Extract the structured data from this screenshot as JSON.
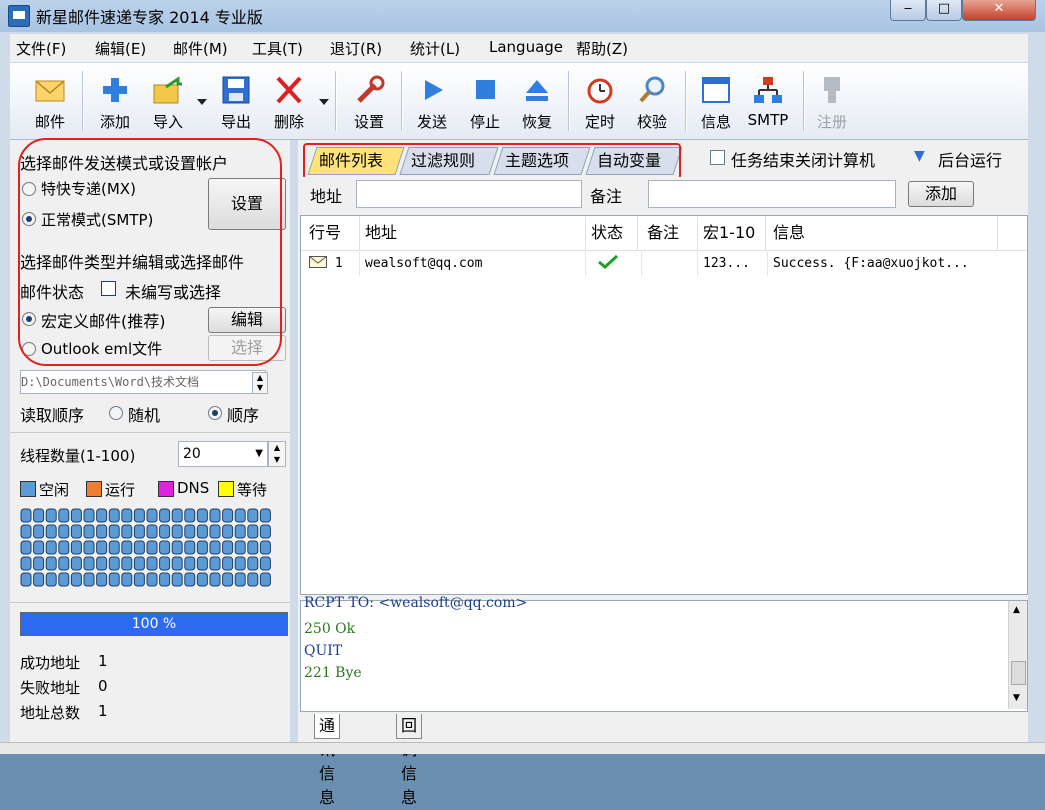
{
  "window": {
    "title": "新星邮件速递专家 2014 专业版",
    "min": "‒",
    "max": "□",
    "close": "✕"
  },
  "menu": [
    "文件(F)",
    "编辑(E)",
    "邮件(M)",
    "工具(T)",
    "退订(R)",
    "统计(L)",
    "Language",
    "帮助(Z)"
  ],
  "toolbar": {
    "mail": "邮件",
    "add": "添加",
    "import": "导入",
    "export": "导出",
    "delete": "删除",
    "settings": "设置",
    "send": "发送",
    "stop": "停止",
    "resume": "恢复",
    "timer": "定时",
    "check": "校验",
    "info": "信息",
    "smtp": "SMTP",
    "register": "注册"
  },
  "left": {
    "section_mode": "选择邮件发送模式或设置帐户",
    "mode_mx": "特快专递(MX)",
    "mode_smtp": "正常模式(SMTP)",
    "settings_btn": "设置",
    "section_type": "选择邮件类型并编辑或选择邮件",
    "mail_status_label": "邮件状态",
    "mail_status_value": "未编写或选择",
    "macro_mail": "宏定义邮件(推荐)",
    "edit_btn": "编辑",
    "eml_file": "Outlook eml文件",
    "select_btn": "选择",
    "path": "D:\\Documents\\Word\\技术文档",
    "read_order": "读取顺序",
    "order_random": "随机",
    "order_seq": "顺序",
    "threads_label": "线程数量(1-100)",
    "threads_value": "20",
    "legend": [
      {
        "label": "空闲",
        "color": "#5b9bd5"
      },
      {
        "label": "运行",
        "color": "#ed7d31"
      },
      {
        "label": "DNS",
        "color": "#e023e0"
      },
      {
        "label": "等待",
        "color": "#ffff00"
      }
    ],
    "progress": "100 %",
    "progress_fraction": 1.0,
    "success_label": "成功地址",
    "success_value": "1",
    "fail_label": "失败地址",
    "fail_value": "0",
    "total_label": "地址总数",
    "total_value": "1"
  },
  "tabs": [
    "邮件列表",
    "过滤规则",
    "主题选项",
    "自动变量"
  ],
  "shutdown_option": "任务结束关闭计算机",
  "background_run": "后台运行",
  "address_label": "地址",
  "note_label": "备注",
  "add_btn": "添加",
  "table": {
    "headers": [
      "行号",
      "地址",
      "状态",
      "备注",
      "宏1-10",
      "信息"
    ],
    "rows": [
      {
        "no": "1",
        "address": "wealsoft@qq.com",
        "status": "ok",
        "note": "",
        "macro": "123...",
        "info": "Success.  {F:aa@xuojkot..."
      }
    ]
  },
  "log": [
    {
      "text": "RCPT TO: <wealsoft@qq.com>",
      "color": "#1a3e8a"
    },
    {
      "text": "250 Ok",
      "color": "#2a7a19"
    },
    {
      "text": "QUIT",
      "color": "#1a3e8a"
    },
    {
      "text": "221 Bye",
      "color": "#2a7a19"
    }
  ],
  "bottom_tabs": [
    "通讯信息",
    "回调信息"
  ]
}
